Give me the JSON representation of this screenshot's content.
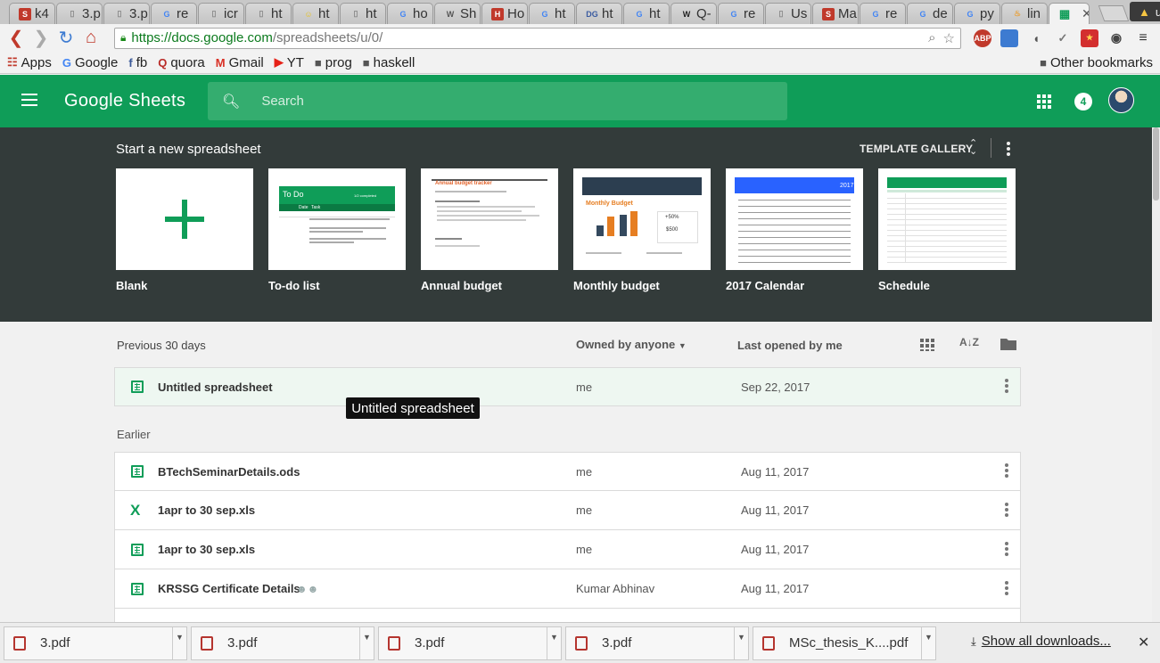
{
  "browser": {
    "tabs": [
      {
        "icon": "s-icon",
        "color": "#c0392b",
        "label": "k4"
      },
      {
        "icon": "page-icon",
        "color": "#888",
        "label": "3.p"
      },
      {
        "icon": "page-icon",
        "color": "#888",
        "label": "3.p"
      },
      {
        "icon": "google-icon",
        "color": "#4285f4",
        "label": "re"
      },
      {
        "icon": "page-icon",
        "color": "#888",
        "label": "icr"
      },
      {
        "icon": "page-icon",
        "color": "#888",
        "label": "ht"
      },
      {
        "icon": "smiley-icon",
        "color": "#e8c21a",
        "label": "ht"
      },
      {
        "icon": "page-icon",
        "color": "#888",
        "label": "ht"
      },
      {
        "icon": "google-icon",
        "color": "#4285f4",
        "label": "ho"
      },
      {
        "icon": "wc-icon",
        "color": "#555",
        "label": "Sh"
      },
      {
        "icon": "h-icon",
        "color": "#c0392b",
        "label": "Ho"
      },
      {
        "icon": "google-icon",
        "color": "#4285f4",
        "label": "ht"
      },
      {
        "icon": "dg-icon",
        "color": "#3a5ba0",
        "label": "ht"
      },
      {
        "icon": "google-icon",
        "color": "#4285f4",
        "label": "ht"
      },
      {
        "icon": "wikipedia-icon",
        "color": "#222",
        "label": "Q-"
      },
      {
        "icon": "google-icon",
        "color": "#4285f4",
        "label": "re"
      },
      {
        "icon": "page-icon",
        "color": "#888",
        "label": "Us"
      },
      {
        "icon": "s-icon",
        "color": "#c0392b",
        "label": "Ma"
      },
      {
        "icon": "google-icon",
        "color": "#4285f4",
        "label": "re"
      },
      {
        "icon": "google-icon",
        "color": "#4285f4",
        "label": "de"
      },
      {
        "icon": "google-icon",
        "color": "#4285f4",
        "label": "py"
      },
      {
        "icon": "flame-icon",
        "color": "#e8a03a",
        "label": "lin"
      }
    ],
    "profile_label": "user",
    "url_host": "https://docs.google.com",
    "url_path": "/spreadsheets/u/0/",
    "bookmarks": [
      {
        "icon": "apps-icon",
        "label": "Apps"
      },
      {
        "icon": "google-icon",
        "label": "Google"
      },
      {
        "icon": "facebook-icon",
        "label": "fb"
      },
      {
        "icon": "quora-icon",
        "label": "quora"
      },
      {
        "icon": "gmail-icon",
        "label": "Gmail"
      },
      {
        "icon": "youtube-icon",
        "label": "YT"
      },
      {
        "icon": "folder-icon",
        "label": "prog"
      },
      {
        "icon": "folder-icon",
        "label": "haskell"
      }
    ],
    "other_bookmarks": "Other bookmarks"
  },
  "app": {
    "logo": "Google Sheets",
    "search_placeholder": "Search",
    "notification_count": "4",
    "brand_color": "#0f9d58"
  },
  "templates": {
    "title": "Start a new spreadsheet",
    "gallery_label": "TEMPLATE GALLERY",
    "items": [
      {
        "label": "Blank"
      },
      {
        "label": "To-do list"
      },
      {
        "label": "Annual budget"
      },
      {
        "label": "Monthly budget"
      },
      {
        "label": "2017 Calendar"
      },
      {
        "label": "Schedule"
      }
    ],
    "todo_thumb": {
      "title": "To Do",
      "count": "1/2 completed",
      "col_date": "Date",
      "col_task": "Task"
    },
    "budget_thumb": {
      "title": "Annual budget tracker"
    },
    "monthly_thumb": {
      "title": "Monthly Budget",
      "pct": "+50%",
      "amount": "$500"
    },
    "calendar_thumb": {
      "year": "2017"
    }
  },
  "files": {
    "recent_label": "Previous 30 days",
    "owner_filter": "Owned by anyone",
    "sort_label": "Last opened by me",
    "earlier_label": "Earlier",
    "recent": [
      {
        "name": "Untitled spreadsheet",
        "owner": "me",
        "date": "Sep 22, 2017",
        "type": "sheet"
      }
    ],
    "earlier": [
      {
        "name": "BTechSeminarDetails.ods",
        "owner": "me",
        "date": "Aug 11, 2017",
        "type": "sheet"
      },
      {
        "name": "1apr to 30 sep.xls",
        "owner": "me",
        "date": "Aug 11, 2017",
        "type": "excel"
      },
      {
        "name": "1apr to 30 sep.xls",
        "owner": "me",
        "date": "Aug 11, 2017",
        "type": "sheet"
      },
      {
        "name": "KRSSG Certificate Details",
        "owner": "Kumar Abhinav",
        "date": "Aug 11, 2017",
        "type": "sheet",
        "shared": true
      }
    ],
    "tooltip": "Untitled spreadsheet"
  },
  "downloads": {
    "items": [
      {
        "label": "3.pdf"
      },
      {
        "label": "3.pdf"
      },
      {
        "label": "3.pdf"
      },
      {
        "label": "3.pdf"
      },
      {
        "label": "MSc_thesis_K....pdf"
      }
    ],
    "show_all": "Show all downloads..."
  }
}
